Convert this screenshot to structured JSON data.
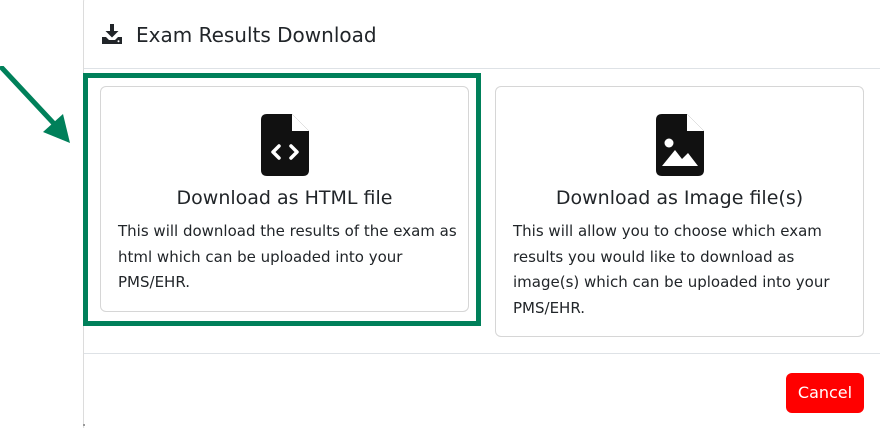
{
  "dialog": {
    "title": "Exam Results Download",
    "title_icon": "download-icon"
  },
  "options": [
    {
      "icon": "file-code-icon",
      "title": "Download as HTML file",
      "description": "This will download the results of the exam as html which can be uploaded into your PMS/EHR."
    },
    {
      "icon": "file-image-icon",
      "title": "Download as Image file(s)",
      "description": "This will allow you to choose which exam results you would like to download as image(s) which can be uploaded into your PMS/EHR."
    }
  ],
  "footer": {
    "cancel_label": "Cancel"
  },
  "annotation": {
    "highlight_color": "#00805a",
    "arrow_color": "#00805a"
  },
  "colors": {
    "cancel_bg": "#ff0000",
    "text": "#212529"
  }
}
